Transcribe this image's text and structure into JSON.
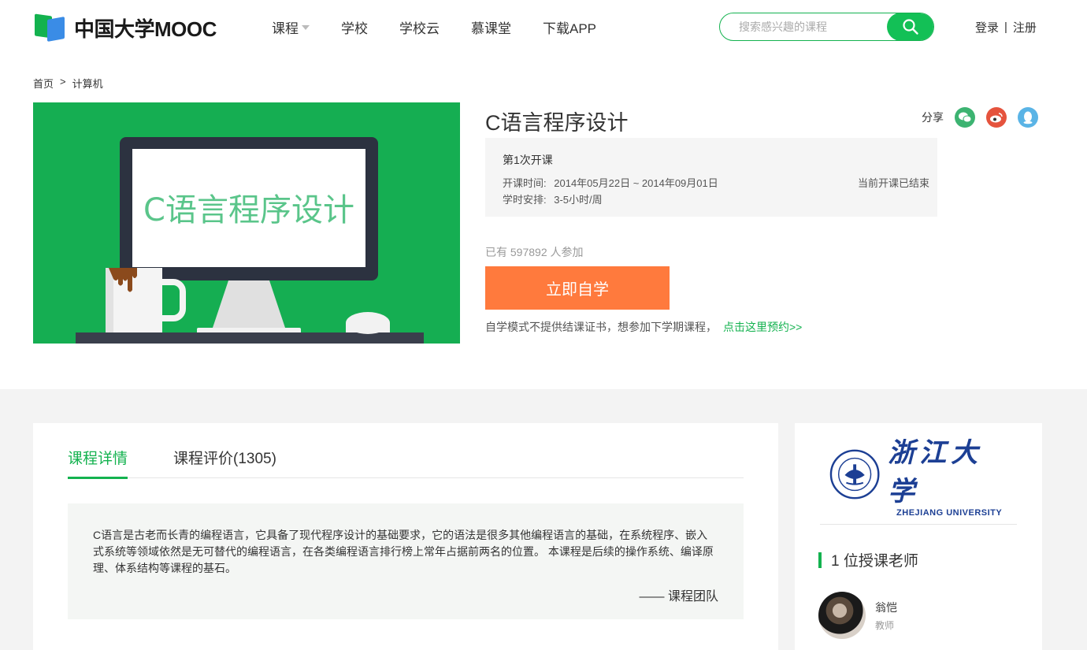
{
  "header": {
    "logo_text": "中国大学MOOC",
    "nav": [
      {
        "label": "课程",
        "has_dropdown": true
      },
      {
        "label": "学校"
      },
      {
        "label": "学校云"
      },
      {
        "label": "慕课堂"
      },
      {
        "label": "下载APP"
      }
    ],
    "search_placeholder": "搜索感兴趣的课程",
    "login": "登录",
    "separator": "|",
    "register": "注册"
  },
  "breadcrumb": {
    "home": "首页",
    "arrow": ">",
    "current": "计算机"
  },
  "banner": {
    "text": "C语言程序设计"
  },
  "course": {
    "title": "C语言程序设计",
    "share_label": "分享",
    "share_icons": [
      "wechat-icon",
      "weibo-icon",
      "qq-icon"
    ],
    "term": {
      "name": "第1次开课",
      "time_label": "开课时间:",
      "time_value": "2014年05月22日 ~ 2014年09月01日",
      "hours_label": "学时安排:",
      "hours_value": "3-5小时/周",
      "status": "当前开课已结束"
    },
    "enrolled": "已有 597892 人参加",
    "cta": "立即自学",
    "note": "自学模式不提供结课证书，想参加下学期课程，",
    "note_link": "点击这里预约>>"
  },
  "tabs": [
    {
      "label": "课程详情",
      "active": true
    },
    {
      "label": "课程评价(1305)",
      "active": false
    }
  ],
  "description": {
    "text": "C语言是古老而长青的编程语言，它具备了现代程序设计的基础要求，它的语法是很多其他编程语言的基础，在系统程序、嵌入式系统等领域依然是无可替代的编程语言，在各类编程语言排行榜上常年占据前两名的位置。 本课程是后续的操作系统、编译原理、体系结构等课程的基石。",
    "signature": "—— 课程团队"
  },
  "university": {
    "name_cn": "浙江大学",
    "name_en": "ZHEJIANG UNIVERSITY"
  },
  "teachers": {
    "title": "1 位授课老师",
    "list": [
      {
        "name": "翁恺",
        "role": "教师"
      }
    ]
  },
  "colors": {
    "brand_green": "#13b24f",
    "cta_orange": "#ff7a3d",
    "banner_green": "#15ae52"
  }
}
